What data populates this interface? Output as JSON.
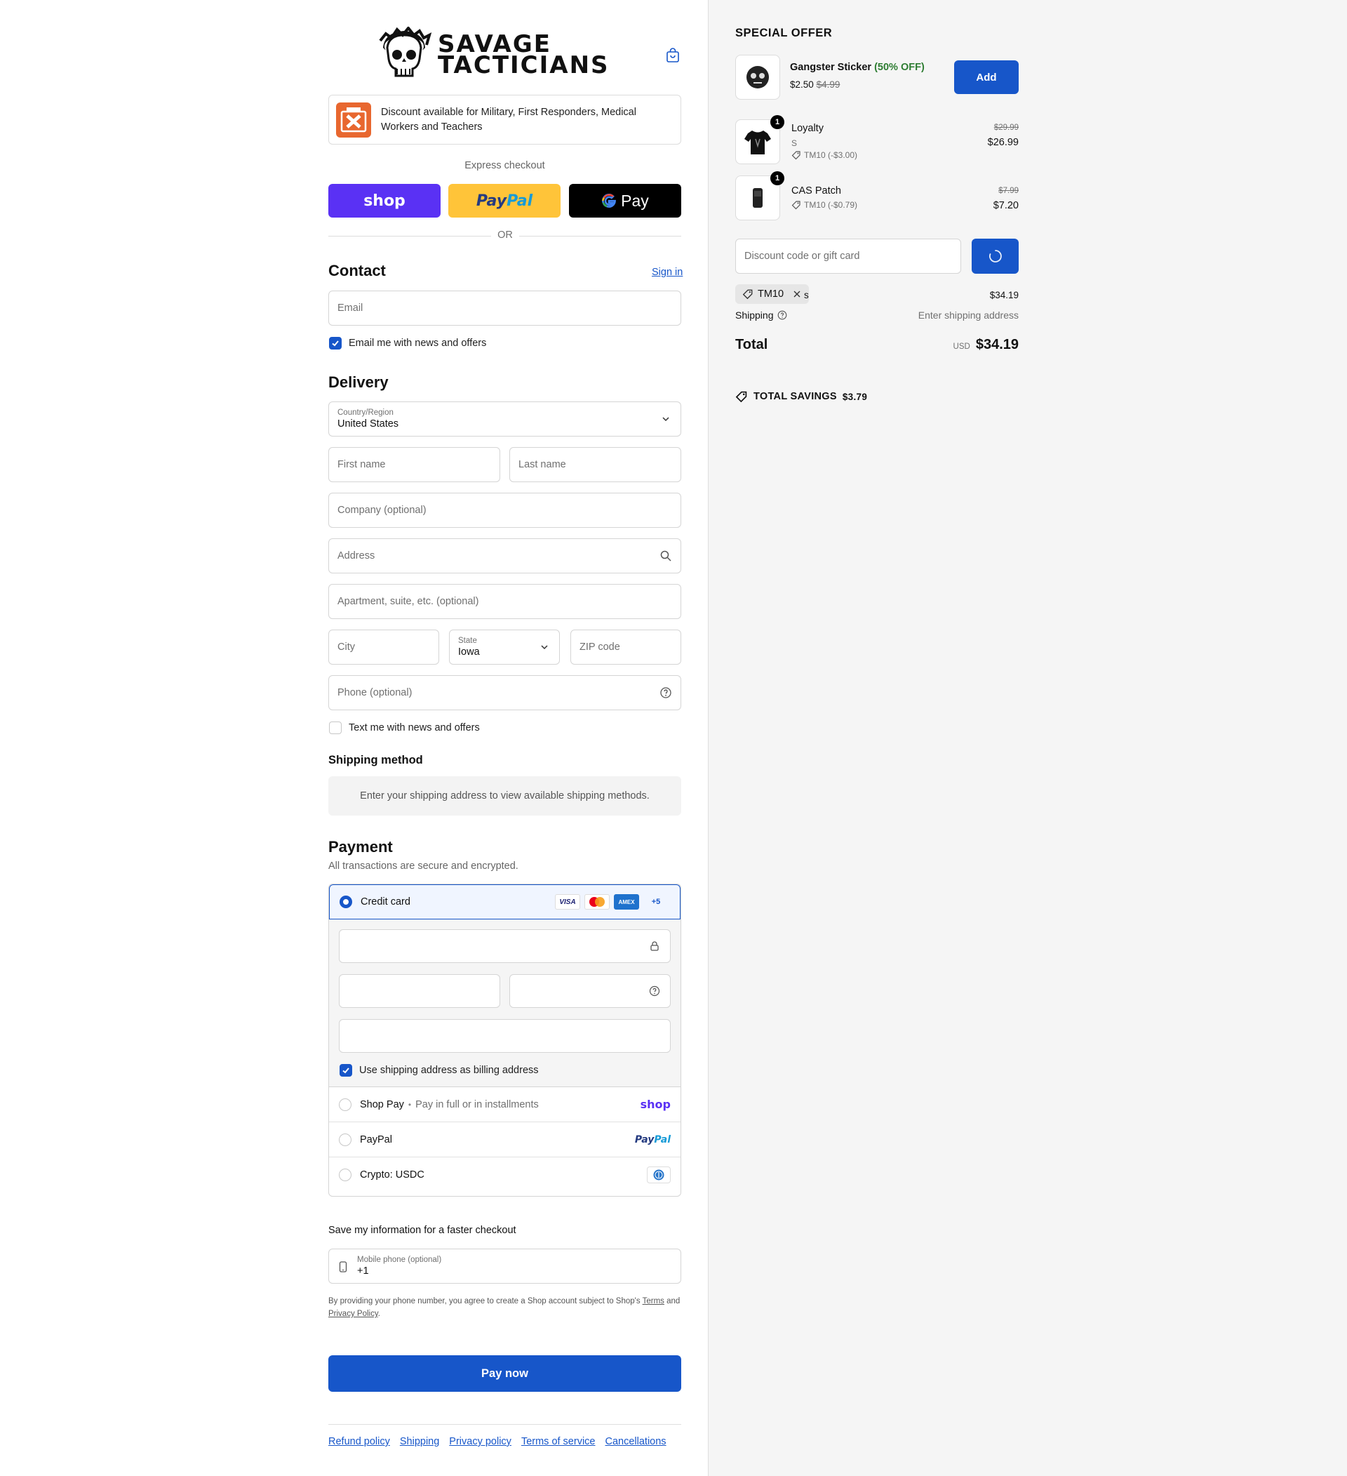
{
  "header": {
    "brand_line1": "SAVAGE",
    "brand_line2": "TACTICIANS",
    "icon": "shopping-bag-icon"
  },
  "banner": {
    "text": "Discount available for Military, First Responders, Medical Workers and Teachers",
    "logo_label": "GOVX ID"
  },
  "express": {
    "title": "Express checkout",
    "shop_label": "shop",
    "paypal_a": "Pay",
    "paypal_b": "Pal",
    "gpay_label": "Pay",
    "or": "OR"
  },
  "contact": {
    "title": "Contact",
    "sign_in": "Sign in",
    "email_placeholder": "Email",
    "news_label": "Email me with news and offers",
    "news_checked": true
  },
  "delivery": {
    "title": "Delivery",
    "country_label": "Country/Region",
    "country_value": "United States",
    "first_name": "First name",
    "last_name": "Last name",
    "company": "Company (optional)",
    "address": "Address",
    "apartment": "Apartment, suite, etc. (optional)",
    "city": "City",
    "state_label": "State",
    "state_value": "Iowa",
    "zip": "ZIP code",
    "phone": "Phone (optional)",
    "text_label": "Text me with news and offers",
    "text_checked": false
  },
  "shipping_method": {
    "title": "Shipping method",
    "message": "Enter your shipping address to view available shipping methods."
  },
  "payment": {
    "title": "Payment",
    "subtitle": "All transactions are secure and encrypted.",
    "credit_card": "Credit card",
    "card_visa": "VISA",
    "card_amex": "AMEX",
    "card_more": "+5",
    "billing_label": "Use shipping address as billing address",
    "billing_checked": true,
    "shop_pay": "Shop Pay",
    "shop_pay_sub": "Pay in full or in installments",
    "shop_pay_logo": "shop",
    "paypal": "PayPal",
    "paypal_logo_a": "Pay",
    "paypal_logo_b": "Pal",
    "crypto": "Crypto: USDC"
  },
  "save_info": {
    "title": "Save my information for a faster checkout",
    "mobile_label": "Mobile phone (optional)",
    "mobile_value": "+1",
    "fine_1": "By providing your phone number, you agree to create a Shop account subject to Shop's",
    "terms": "Terms",
    "and": "and",
    "privacy": "Privacy Policy",
    "period": "."
  },
  "pay_now": "Pay now",
  "footer_links": [
    "Refund policy",
    "Shipping",
    "Privacy policy",
    "Terms of service",
    "Cancellations"
  ],
  "offer": {
    "title": "SPECIAL OFFER",
    "name": "Gangster Sticker",
    "discount": "(50% OFF)",
    "price": "$2.50",
    "compare": "$4.99",
    "add": "Add"
  },
  "cart": [
    {
      "name": "Loyalty",
      "variant": "S",
      "discount": "TM10 (-$3.00)",
      "compare": "$29.99",
      "price": "$26.99",
      "qty": "1"
    },
    {
      "name": "CAS Patch",
      "discount": "TM10 (-$0.79)",
      "compare": "$7.99",
      "price": "$7.20",
      "qty": "1"
    }
  ],
  "discount_field": {
    "placeholder": "Discount code or gift card"
  },
  "summary": {
    "chip_code": "TM10",
    "subtotal_trail": "s",
    "subtotal": "$34.19",
    "shipping_label": "Shipping",
    "shipping_value": "Enter shipping address",
    "total_label": "Total",
    "currency": "USD",
    "total": "$34.19",
    "savings_label": "TOTAL SAVINGS",
    "savings_value": "$3.79"
  },
  "colors": {
    "accent": "#1756c9",
    "shop": "#5a31f4",
    "paypal": "#ffc439",
    "offer_green": "#2e7d32"
  }
}
